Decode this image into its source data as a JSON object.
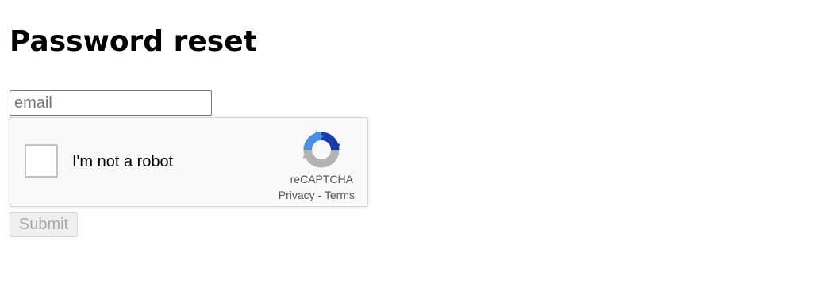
{
  "page": {
    "title": "Password reset"
  },
  "form": {
    "email_placeholder": "email",
    "email_value": "",
    "submit_label": "Submit",
    "submit_disabled": true
  },
  "recaptcha": {
    "checkbox_label": "I'm not a robot",
    "checked": false,
    "brand": "reCAPTCHA",
    "privacy_label": "Privacy",
    "separator": " - ",
    "terms_label": "Terms",
    "logo_icon": "recaptcha-logo-icon",
    "colors": {
      "background": "#f9f9f9",
      "border": "#d3d3d3",
      "logo_blue_dark": "#1c3aa9",
      "logo_blue": "#4a90e2",
      "logo_gray": "#b3b3b3"
    }
  }
}
